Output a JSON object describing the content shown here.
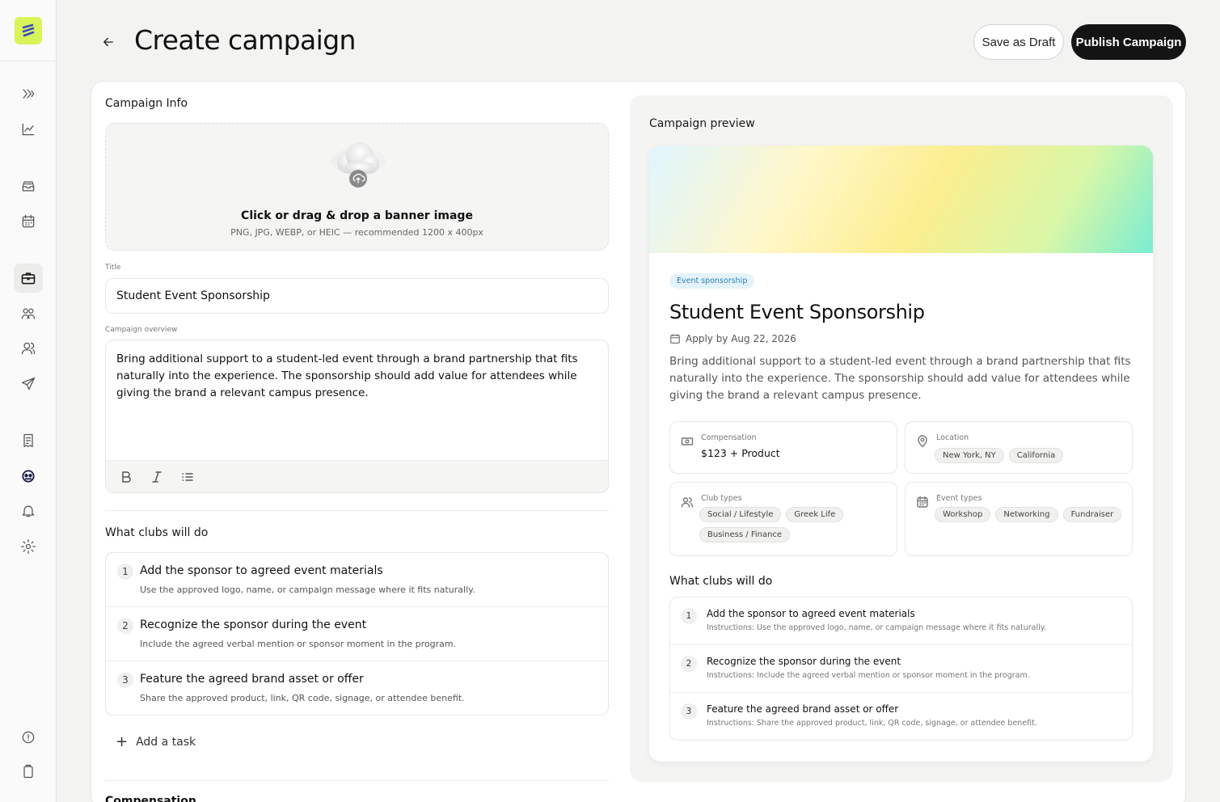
{
  "app": {
    "page_title": "Create campaign",
    "save_draft_label": "Save as Draft",
    "publish_label": "Publish Campaign",
    "accent_color": "#d8f45a"
  },
  "sidebar": {
    "icons": [
      "chevrons-icon",
      "analytics-icon",
      "inbox-icon",
      "calendar-icon",
      "briefcase-icon",
      "groups-icon",
      "users-icon",
      "send-icon",
      "receipt-icon",
      "support-icon",
      "bell-icon",
      "gear-icon",
      "alert-icon",
      "clipboard-icon"
    ],
    "active": "briefcase-icon"
  },
  "form": {
    "campaign_info_label": "Campaign Info",
    "upload_title": "Click or drag & drop a banner image",
    "upload_hint": "PNG, JPG, WEBP, or HEIC — recommended 1200 x 400px",
    "title_label": "Title",
    "title_value": "Student Event Sponsorship",
    "overview_label": "Campaign overview",
    "overview_value": "Bring additional support to a student-led event through a brand partnership that fits naturally into the experience. The sponsorship should add value for attendees while giving the brand a relevant campus presence.",
    "tasks_label": "What clubs will do",
    "tasks": [
      {
        "num": "1",
        "title": "Add the sponsor to agreed event materials",
        "desc": "Use the approved logo, name, or campaign message where it fits naturally."
      },
      {
        "num": "2",
        "title": "Recognize the sponsor during the event",
        "desc": "Include the agreed verbal mention or sponsor moment in the program."
      },
      {
        "num": "3",
        "title": "Feature the agreed brand asset or offer",
        "desc": "Share the approved product, link, QR code, signage, or attendee benefit."
      }
    ],
    "add_task_label": "Add a task",
    "next_section_label": "Compensation"
  },
  "preview": {
    "label": "Campaign preview",
    "tag": "Event sponsorship",
    "title": "Student Event Sponsorship",
    "apply_by": "Apply by Aug 22, 2026",
    "overview": "Bring additional support to a student-led event through a brand partnership that fits naturally into the experience. The sponsorship should add value for attendees while giving the brand a relevant campus presence.",
    "compensation_label": "Compensation",
    "compensation_value": "$123 + Product",
    "location_label": "Location",
    "locations": [
      "New York, NY",
      "California"
    ],
    "club_types_label": "Club types",
    "club_types": [
      "Social / Lifestyle",
      "Greek Life",
      "Business / Finance"
    ],
    "event_types_label": "Event types",
    "event_types": [
      "Workshop",
      "Networking",
      "Fundraiser"
    ],
    "tasks_label": "What clubs will do",
    "tasks": [
      {
        "num": "1",
        "title": "Add the sponsor to agreed event materials",
        "desc": "Instructions: Use the approved logo, name, or campaign message where it fits naturally."
      },
      {
        "num": "2",
        "title": "Recognize the sponsor during the event",
        "desc": "Instructions: Include the agreed verbal mention or sponsor moment in the program."
      },
      {
        "num": "3",
        "title": "Feature the agreed brand asset or offer",
        "desc": "Instructions: Share the approved product, link, QR code, signage, or attendee benefit."
      }
    ]
  }
}
